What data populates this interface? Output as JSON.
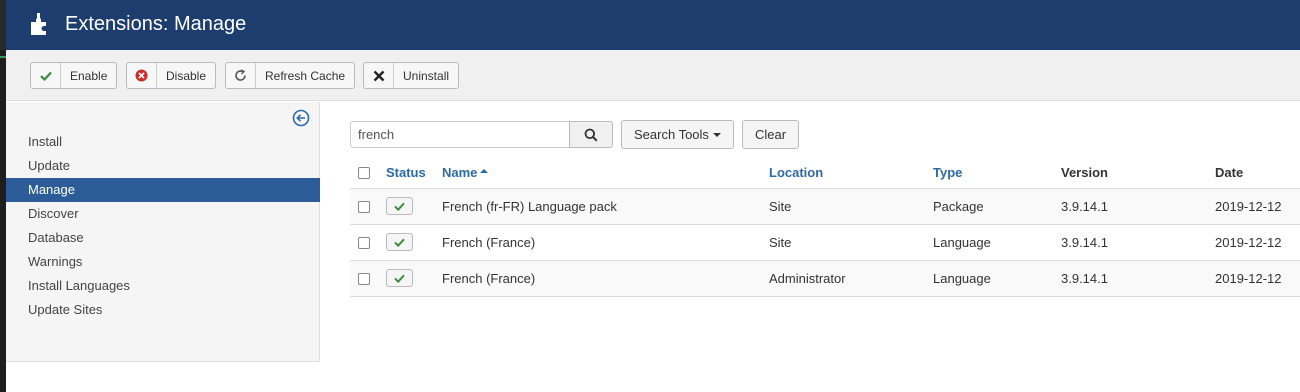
{
  "header": {
    "title": "Extensions: Manage",
    "icon": "puzzle-piece-icon"
  },
  "toolbar": {
    "enable_label": "Enable",
    "disable_label": "Disable",
    "refresh_label": "Refresh Cache",
    "uninstall_label": "Uninstall"
  },
  "sidebar": {
    "items": [
      {
        "label": "Install",
        "active": false
      },
      {
        "label": "Update",
        "active": false
      },
      {
        "label": "Manage",
        "active": true
      },
      {
        "label": "Discover",
        "active": false
      },
      {
        "label": "Database",
        "active": false
      },
      {
        "label": "Warnings",
        "active": false
      },
      {
        "label": "Install Languages",
        "active": false
      },
      {
        "label": "Update Sites",
        "active": false
      }
    ]
  },
  "search": {
    "value": "french",
    "search_tools_label": "Search Tools",
    "clear_label": "Clear"
  },
  "table": {
    "columns": [
      "Status",
      "Name",
      "Location",
      "Type",
      "Version",
      "Date"
    ],
    "rows": [
      {
        "name": "French (fr-FR) Language pack",
        "location": "Site",
        "type": "Package",
        "version": "3.9.14.1",
        "date": "2019-12-12"
      },
      {
        "name": "French (France)",
        "location": "Site",
        "type": "Language",
        "version": "3.9.14.1",
        "date": "2019-12-12"
      },
      {
        "name": "French (France)",
        "location": "Administrator",
        "type": "Language",
        "version": "3.9.14.1",
        "date": "2019-12-12"
      }
    ]
  },
  "colors": {
    "header_bg": "#1c3d6e",
    "active_bg": "#2d5d98",
    "link": "#2d6aa8",
    "check": "#3c8b3c",
    "disable": "#c9302c"
  }
}
